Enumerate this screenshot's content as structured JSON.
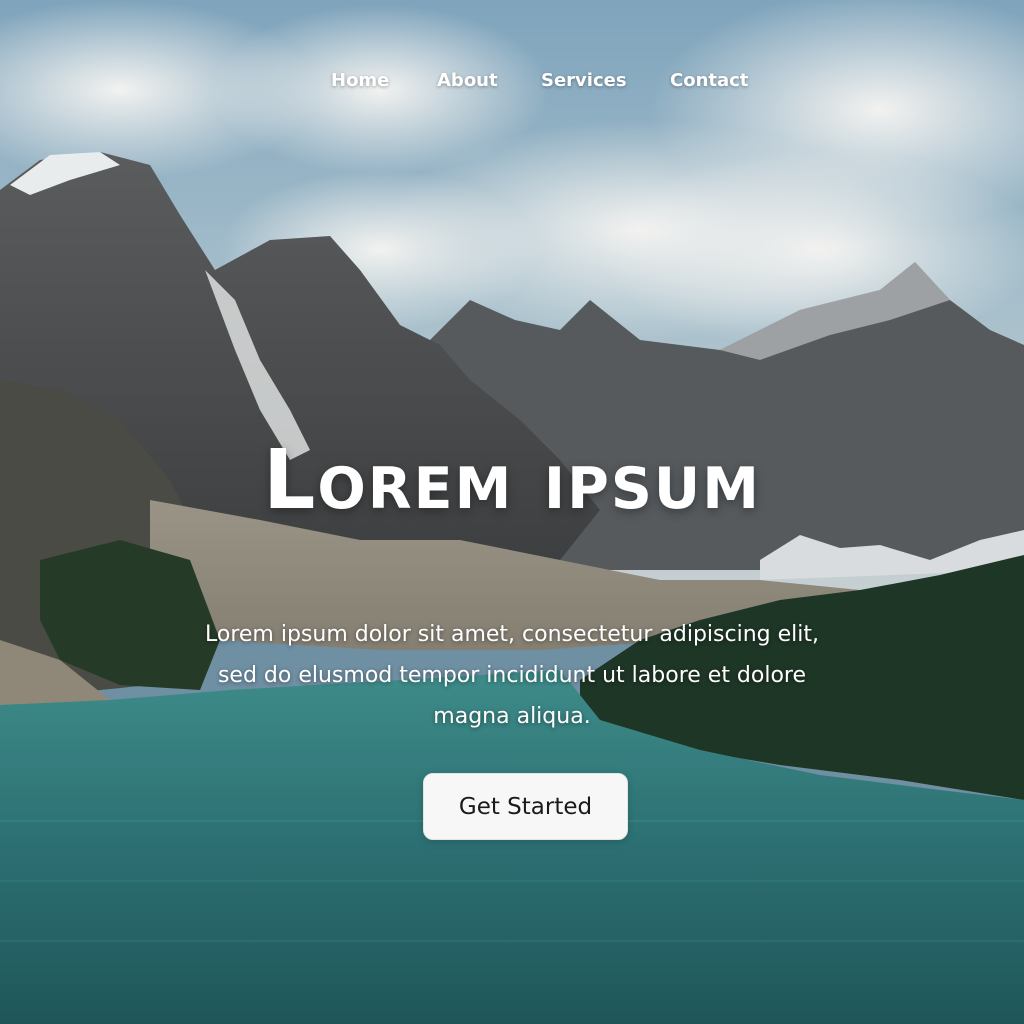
{
  "nav": {
    "items": [
      {
        "label": "Home"
      },
      {
        "label": "About"
      },
      {
        "label": "Services"
      },
      {
        "label": "Contact"
      }
    ]
  },
  "hero": {
    "title": "Lorem ipsum",
    "description": "Lorem ipsum dolor sit amet, consectetur adipiscing elit, sed do elusmod tempor incididunt ut labore et dolore magna aliqua.",
    "cta_label": "Get Started"
  },
  "colors": {
    "sky": "#8fb2c8",
    "cloud": "#ececec",
    "mountain": "#4b4d4f",
    "lake": "#2f7b7c",
    "forest": "#1e3525",
    "button_bg": "#f7f7f7",
    "text": "#ffffff"
  }
}
